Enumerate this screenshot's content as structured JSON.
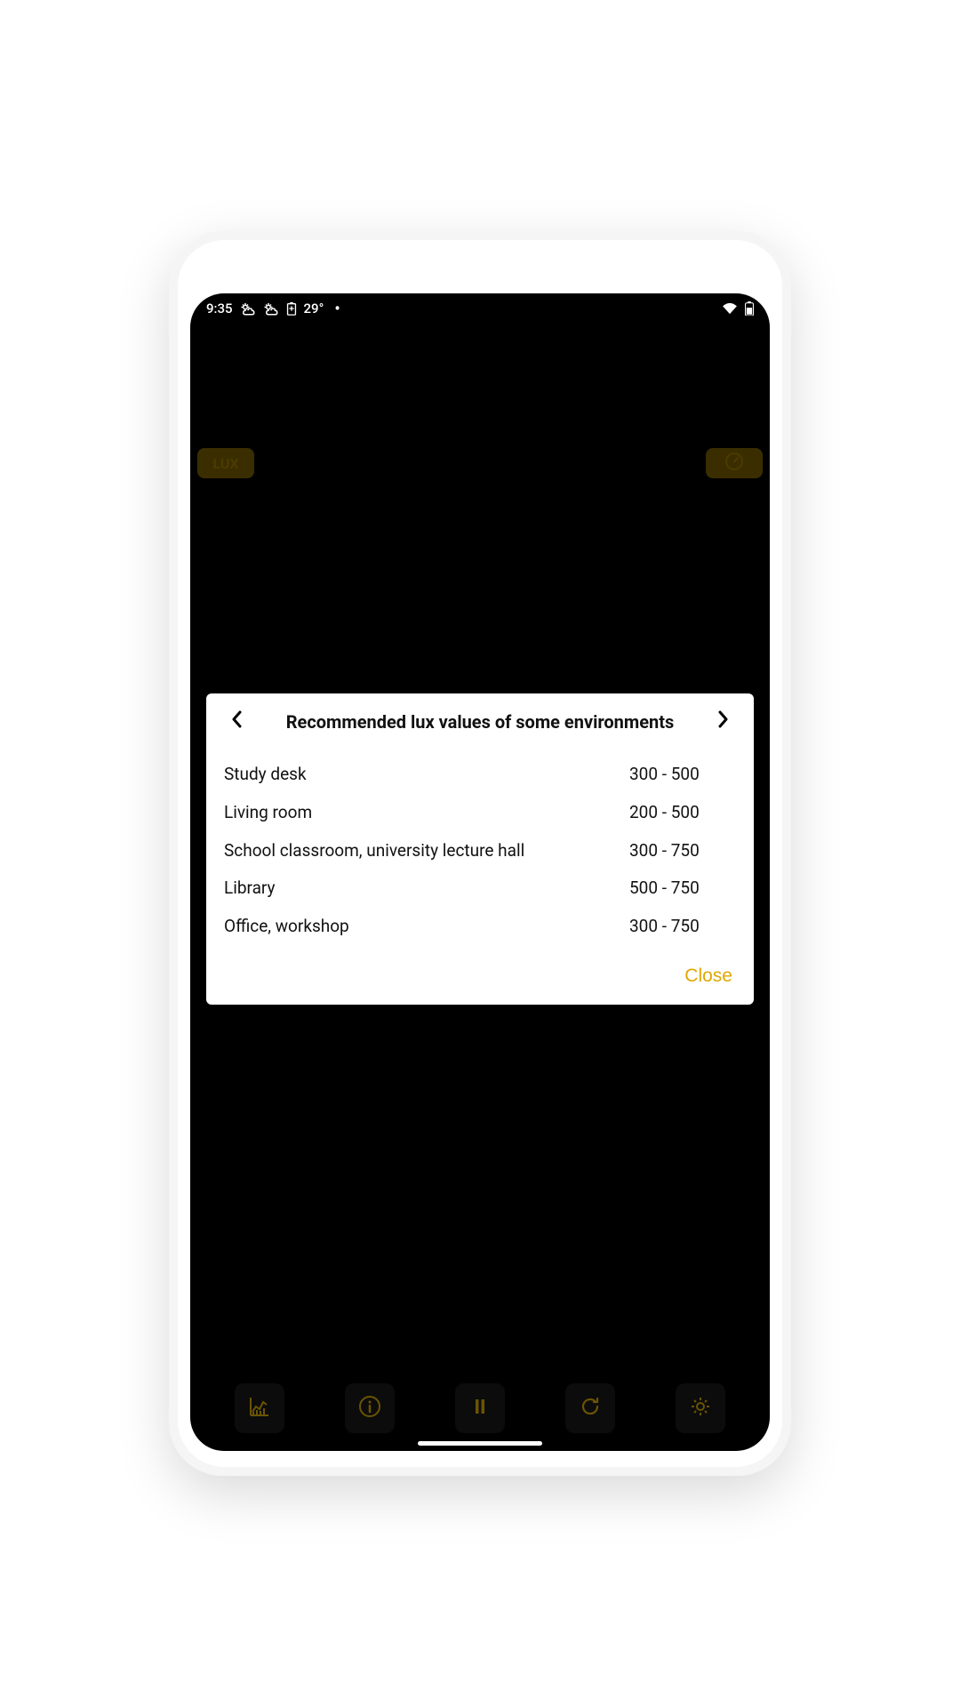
{
  "statusbar": {
    "time": "9:35",
    "temperature": "29°"
  },
  "app": {
    "lux_badge": "LUX"
  },
  "modal": {
    "title": "Recommended lux values of some environments",
    "close_label": "Close",
    "rows": [
      {
        "env": "Study desk",
        "val": "300 - 500"
      },
      {
        "env": "Living room",
        "val": "200 - 500"
      },
      {
        "env": "School classroom, university lecture hall",
        "val": "300 - 750"
      },
      {
        "env": "Library",
        "val": "500 - 750"
      },
      {
        "env": "Office, workshop",
        "val": "300 - 750"
      }
    ]
  }
}
